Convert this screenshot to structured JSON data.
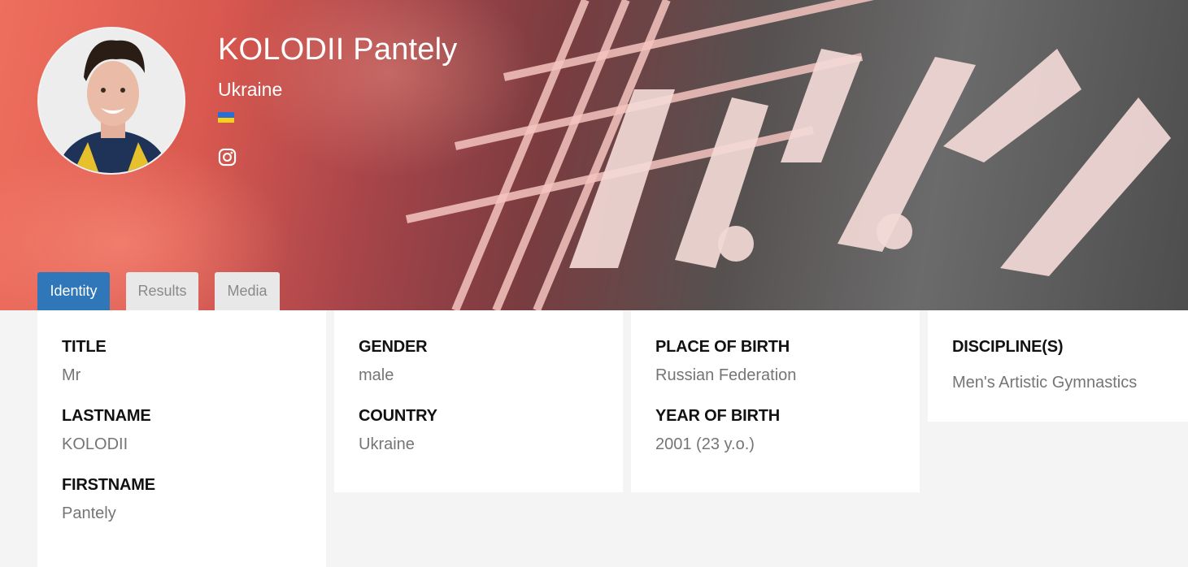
{
  "athlete": {
    "name": "KOLODII Pantely",
    "country": "Ukraine",
    "flag_colors": {
      "top": "#2d6cd2",
      "bottom": "#f6d11a"
    }
  },
  "social": {
    "icon": "instagram-icon"
  },
  "tabs": [
    {
      "label": "Identity",
      "active": true
    },
    {
      "label": "Results",
      "active": false
    },
    {
      "label": "Media",
      "active": false
    }
  ],
  "identity": {
    "title": {
      "label": "TITLE",
      "value": "Mr"
    },
    "lastname": {
      "label": "LASTNAME",
      "value": "KOLODII"
    },
    "firstname": {
      "label": "FIRSTNAME",
      "value": "Pantely"
    },
    "gender": {
      "label": "GENDER",
      "value": "male"
    },
    "country": {
      "label": "COUNTRY",
      "value": "Ukraine"
    },
    "place_of_birth": {
      "label": "PLACE OF BIRTH",
      "value": "Russian Federation"
    },
    "year_of_birth": {
      "label": "YEAR OF BIRTH",
      "value": "2001 (23 y.o.)"
    },
    "disciplines": {
      "label": "DISCIPLINE(S)",
      "value": "Men's Artistic Gymnastics"
    }
  },
  "colors": {
    "accent": "#2f77b8",
    "tab_inactive_bg": "#e8e8e8",
    "page_bg": "#f4f4f4"
  }
}
